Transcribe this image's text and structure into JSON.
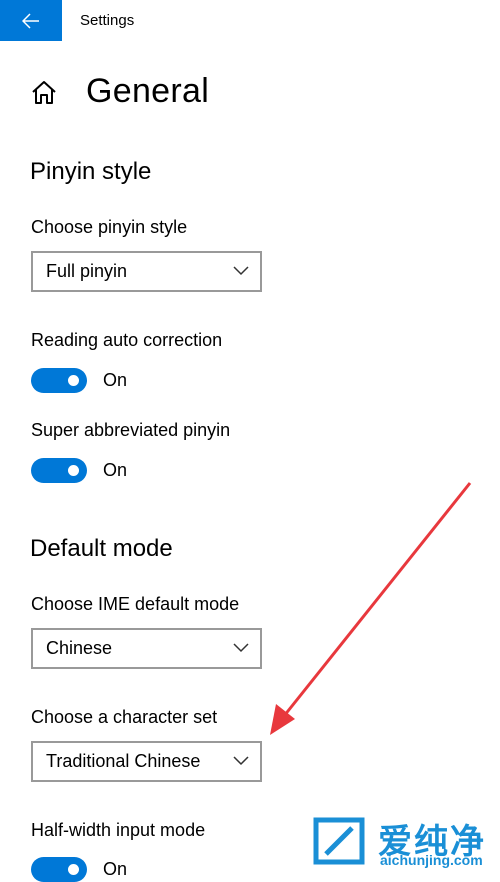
{
  "window": {
    "title": "Settings"
  },
  "page": {
    "title": "General"
  },
  "pinyin_section": {
    "title": "Pinyin style",
    "style_label": "Choose pinyin style",
    "style_value": "Full pinyin",
    "reading_label": "Reading auto correction",
    "reading_state": "On",
    "super_label": "Super abbreviated pinyin",
    "super_state": "On"
  },
  "default_section": {
    "title": "Default mode",
    "ime_label": "Choose IME default mode",
    "ime_value": "Chinese",
    "charset_label": "Choose a character set",
    "charset_value": "Traditional Chinese",
    "halfwidth_label": "Half-width input mode",
    "halfwidth_state": "On"
  },
  "watermark": {
    "chinese": "爱纯净",
    "site": "aichunjing.com"
  },
  "colors": {
    "accent": "#0078d7",
    "annotation_arrow": "#e8383d"
  }
}
